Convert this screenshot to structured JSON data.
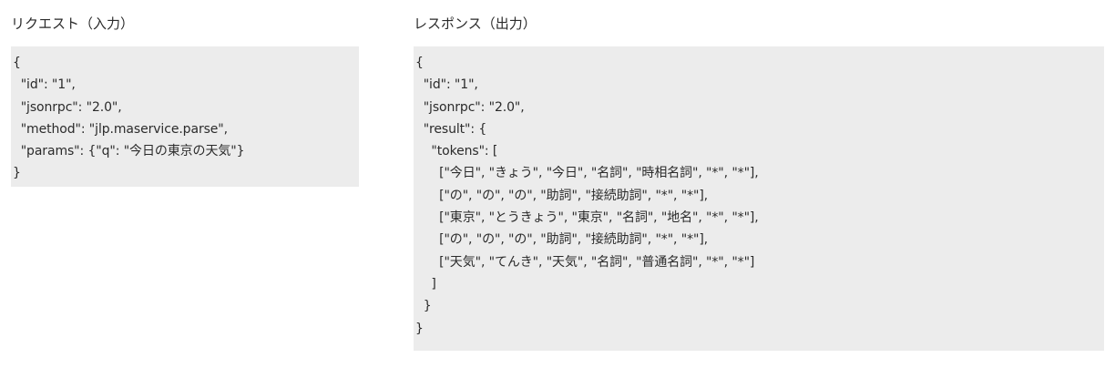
{
  "request": {
    "title": "リクエスト（入力）",
    "lines": [
      "{",
      "  \"id\": \"1\",",
      "  \"jsonrpc\": \"2.0\",",
      "  \"method\": \"jlp.maservice.parse\",",
      "  \"params\": {\"q\": \"今日の東京の天気\"}",
      "}"
    ]
  },
  "response": {
    "title": "レスポンス（出力）",
    "lines": [
      "{",
      "  \"id\": \"1\",",
      "  \"jsonrpc\": \"2.0\",",
      "  \"result\": {",
      "    \"tokens\": [",
      "      [\"今日\", \"きょう\", \"今日\", \"名詞\", \"時相名詞\", \"*\", \"*\"],",
      "      [\"の\", \"の\", \"の\", \"助詞\", \"接続助詞\", \"*\", \"*\"],",
      "      [\"東京\", \"とうきょう\", \"東京\", \"名詞\", \"地名\", \"*\", \"*\"],",
      "      [\"の\", \"の\", \"の\", \"助詞\", \"接続助詞\", \"*\", \"*\"],",
      "      [\"天気\", \"てんき\", \"天気\", \"名詞\", \"普通名詞\", \"*\", \"*\"]",
      "    ]",
      "  }",
      "}"
    ]
  }
}
